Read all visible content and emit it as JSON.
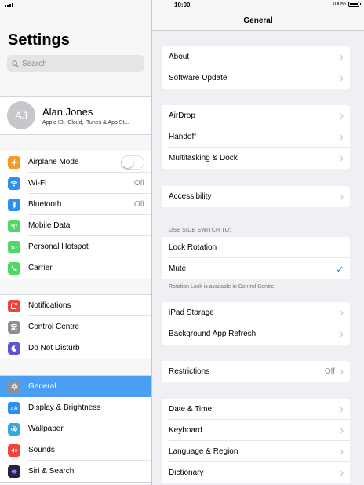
{
  "status": {
    "time": "10:00",
    "battery": "100%"
  },
  "left": {
    "title": "Settings",
    "search_placeholder": "Search",
    "profile": {
      "initials": "AJ",
      "name": "Alan Jones",
      "subtitle": "Apple ID, iCloud, iTunes & App St..."
    },
    "connectivity": [
      {
        "label": "Airplane Mode",
        "icon": "airplane-icon",
        "color": "#f79a2a",
        "value": ""
      },
      {
        "label": "Wi-Fi",
        "icon": "wifi-icon",
        "color": "#2f8ef2",
        "value": "Off"
      },
      {
        "label": "Bluetooth",
        "icon": "bluetooth-icon",
        "color": "#2f8ef2",
        "value": "Off"
      },
      {
        "label": "Mobile Data",
        "icon": "antenna-icon",
        "color": "#4cd964",
        "value": ""
      },
      {
        "label": "Personal Hotspot",
        "icon": "hotspot-icon",
        "color": "#4cd964",
        "value": ""
      },
      {
        "label": "Carrier",
        "icon": "phone-icon",
        "color": "#4cd964",
        "value": ""
      }
    ],
    "notifications": [
      {
        "label": "Notifications",
        "icon": "notifications-icon",
        "color": "#f2443c"
      },
      {
        "label": "Control Centre",
        "icon": "switches-icon",
        "color": "#8e8e93"
      },
      {
        "label": "Do Not Disturb",
        "icon": "moon-icon",
        "color": "#5b54d4"
      }
    ],
    "general": [
      {
        "label": "General",
        "icon": "gear-icon",
        "color": "#8e8e93"
      },
      {
        "label": "Display & Brightness",
        "icon": "text-size-icon",
        "color": "#2f8ef2"
      },
      {
        "label": "Wallpaper",
        "icon": "flower-icon",
        "color": "#37aadc"
      },
      {
        "label": "Sounds",
        "icon": "speaker-icon",
        "color": "#f2443c"
      },
      {
        "label": "Siri & Search",
        "icon": "siri-icon",
        "color": "#222244"
      }
    ]
  },
  "right": {
    "nav_title": "General",
    "group1": [
      "About",
      "Software Update"
    ],
    "group2": [
      "AirDrop",
      "Handoff",
      "Multitasking & Dock"
    ],
    "group3": [
      "Accessibility"
    ],
    "side_switch_header": "USE SIDE SWITCH TO:",
    "side_switch": [
      "Lock Rotation",
      "Mute"
    ],
    "side_switch_footer": "Rotation Lock is available in Control Centre.",
    "group5": [
      "iPad Storage",
      "Background App Refresh"
    ],
    "restrictions": {
      "label": "Restrictions",
      "value": "Off"
    },
    "group7": [
      "Date & Time",
      "Keyboard",
      "Language & Region",
      "Dictionary"
    ]
  }
}
